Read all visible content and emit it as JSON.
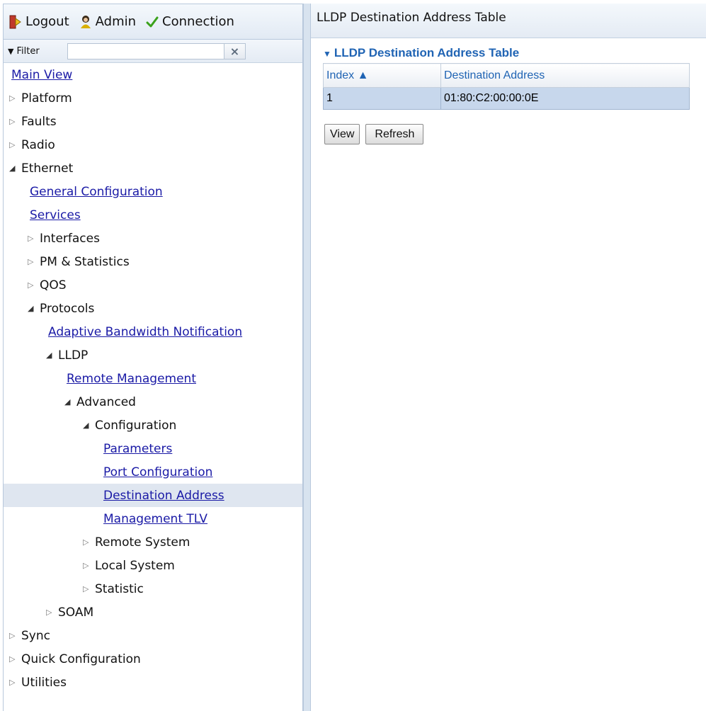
{
  "topbar": {
    "logout_label": "Logout",
    "admin_label": "Admin",
    "connection_label": "Connection"
  },
  "filter": {
    "label": "Filter",
    "value": "",
    "clear_label": "×"
  },
  "tree": {
    "main_view": "Main View",
    "platform": "Platform",
    "faults": "Faults",
    "radio": "Radio",
    "ethernet": "Ethernet",
    "general_configuration": "General Configuration",
    "services": "Services",
    "interfaces": "Interfaces",
    "pm_statistics": "PM & Statistics",
    "qos": "QOS",
    "protocols": "Protocols",
    "adaptive_bandwidth_notification": "Adaptive Bandwidth Notification",
    "lldp": "LLDP",
    "remote_management": "Remote Management",
    "advanced": "Advanced",
    "configuration": "Configuration",
    "parameters": "Parameters",
    "port_configuration": "Port Configuration",
    "destination_address": "Destination Address",
    "management_tlv": "Management TLV",
    "remote_system": "Remote System",
    "local_system": "Local System",
    "statistic": "Statistic",
    "soam": "SOAM",
    "sync": "Sync",
    "quick_configuration": "Quick Configuration",
    "utilities": "Utilities"
  },
  "main": {
    "page_title": "LLDP Destination Address Table",
    "section_title": "LLDP Destination Address Table",
    "table": {
      "headers": {
        "index": "Index ▲",
        "destination_address": "Destination Address"
      },
      "rows": [
        {
          "index": "1",
          "destination_address": "01:80:C2:00:00:0E"
        }
      ]
    },
    "buttons": {
      "view": "View",
      "refresh": "Refresh"
    }
  },
  "colors": {
    "link": "#1a1aa6",
    "accent": "#2064b4",
    "selected_row": "#c7d7ec",
    "tree_selected": "#dfe6f0"
  }
}
